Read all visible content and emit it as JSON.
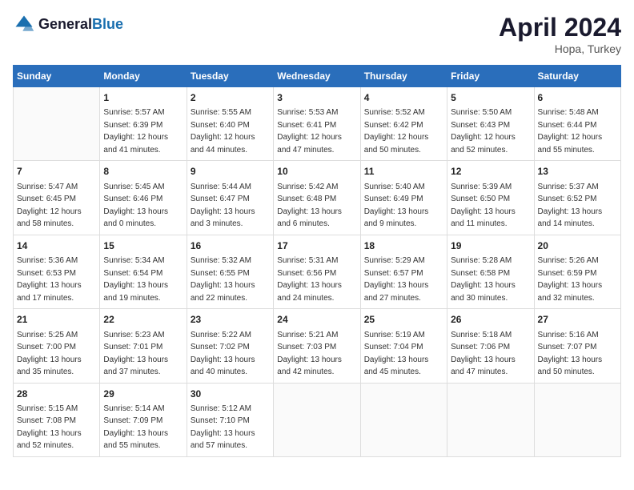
{
  "header": {
    "logo_general": "General",
    "logo_blue": "Blue",
    "title": "April 2024",
    "location": "Hopa, Turkey"
  },
  "weekdays": [
    "Sunday",
    "Monday",
    "Tuesday",
    "Wednesday",
    "Thursday",
    "Friday",
    "Saturday"
  ],
  "weeks": [
    [
      {
        "day": "",
        "info": ""
      },
      {
        "day": "1",
        "info": "Sunrise: 5:57 AM\nSunset: 6:39 PM\nDaylight: 12 hours\nand 41 minutes."
      },
      {
        "day": "2",
        "info": "Sunrise: 5:55 AM\nSunset: 6:40 PM\nDaylight: 12 hours\nand 44 minutes."
      },
      {
        "day": "3",
        "info": "Sunrise: 5:53 AM\nSunset: 6:41 PM\nDaylight: 12 hours\nand 47 minutes."
      },
      {
        "day": "4",
        "info": "Sunrise: 5:52 AM\nSunset: 6:42 PM\nDaylight: 12 hours\nand 50 minutes."
      },
      {
        "day": "5",
        "info": "Sunrise: 5:50 AM\nSunset: 6:43 PM\nDaylight: 12 hours\nand 52 minutes."
      },
      {
        "day": "6",
        "info": "Sunrise: 5:48 AM\nSunset: 6:44 PM\nDaylight: 12 hours\nand 55 minutes."
      }
    ],
    [
      {
        "day": "7",
        "info": "Sunrise: 5:47 AM\nSunset: 6:45 PM\nDaylight: 12 hours\nand 58 minutes."
      },
      {
        "day": "8",
        "info": "Sunrise: 5:45 AM\nSunset: 6:46 PM\nDaylight: 13 hours\nand 0 minutes."
      },
      {
        "day": "9",
        "info": "Sunrise: 5:44 AM\nSunset: 6:47 PM\nDaylight: 13 hours\nand 3 minutes."
      },
      {
        "day": "10",
        "info": "Sunrise: 5:42 AM\nSunset: 6:48 PM\nDaylight: 13 hours\nand 6 minutes."
      },
      {
        "day": "11",
        "info": "Sunrise: 5:40 AM\nSunset: 6:49 PM\nDaylight: 13 hours\nand 9 minutes."
      },
      {
        "day": "12",
        "info": "Sunrise: 5:39 AM\nSunset: 6:50 PM\nDaylight: 13 hours\nand 11 minutes."
      },
      {
        "day": "13",
        "info": "Sunrise: 5:37 AM\nSunset: 6:52 PM\nDaylight: 13 hours\nand 14 minutes."
      }
    ],
    [
      {
        "day": "14",
        "info": "Sunrise: 5:36 AM\nSunset: 6:53 PM\nDaylight: 13 hours\nand 17 minutes."
      },
      {
        "day": "15",
        "info": "Sunrise: 5:34 AM\nSunset: 6:54 PM\nDaylight: 13 hours\nand 19 minutes."
      },
      {
        "day": "16",
        "info": "Sunrise: 5:32 AM\nSunset: 6:55 PM\nDaylight: 13 hours\nand 22 minutes."
      },
      {
        "day": "17",
        "info": "Sunrise: 5:31 AM\nSunset: 6:56 PM\nDaylight: 13 hours\nand 24 minutes."
      },
      {
        "day": "18",
        "info": "Sunrise: 5:29 AM\nSunset: 6:57 PM\nDaylight: 13 hours\nand 27 minutes."
      },
      {
        "day": "19",
        "info": "Sunrise: 5:28 AM\nSunset: 6:58 PM\nDaylight: 13 hours\nand 30 minutes."
      },
      {
        "day": "20",
        "info": "Sunrise: 5:26 AM\nSunset: 6:59 PM\nDaylight: 13 hours\nand 32 minutes."
      }
    ],
    [
      {
        "day": "21",
        "info": "Sunrise: 5:25 AM\nSunset: 7:00 PM\nDaylight: 13 hours\nand 35 minutes."
      },
      {
        "day": "22",
        "info": "Sunrise: 5:23 AM\nSunset: 7:01 PM\nDaylight: 13 hours\nand 37 minutes."
      },
      {
        "day": "23",
        "info": "Sunrise: 5:22 AM\nSunset: 7:02 PM\nDaylight: 13 hours\nand 40 minutes."
      },
      {
        "day": "24",
        "info": "Sunrise: 5:21 AM\nSunset: 7:03 PM\nDaylight: 13 hours\nand 42 minutes."
      },
      {
        "day": "25",
        "info": "Sunrise: 5:19 AM\nSunset: 7:04 PM\nDaylight: 13 hours\nand 45 minutes."
      },
      {
        "day": "26",
        "info": "Sunrise: 5:18 AM\nSunset: 7:06 PM\nDaylight: 13 hours\nand 47 minutes."
      },
      {
        "day": "27",
        "info": "Sunrise: 5:16 AM\nSunset: 7:07 PM\nDaylight: 13 hours\nand 50 minutes."
      }
    ],
    [
      {
        "day": "28",
        "info": "Sunrise: 5:15 AM\nSunset: 7:08 PM\nDaylight: 13 hours\nand 52 minutes."
      },
      {
        "day": "29",
        "info": "Sunrise: 5:14 AM\nSunset: 7:09 PM\nDaylight: 13 hours\nand 55 minutes."
      },
      {
        "day": "30",
        "info": "Sunrise: 5:12 AM\nSunset: 7:10 PM\nDaylight: 13 hours\nand 57 minutes."
      },
      {
        "day": "",
        "info": ""
      },
      {
        "day": "",
        "info": ""
      },
      {
        "day": "",
        "info": ""
      },
      {
        "day": "",
        "info": ""
      }
    ]
  ]
}
